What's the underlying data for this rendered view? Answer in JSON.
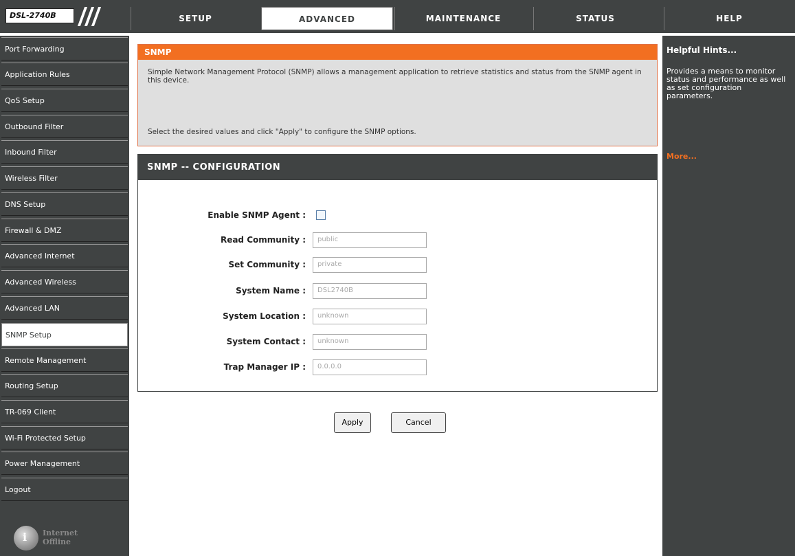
{
  "header": {
    "logo_text": "DSL-2740B",
    "tabs": [
      {
        "label": "SETUP"
      },
      {
        "label": "ADVANCED"
      },
      {
        "label": "MAINTENANCE"
      },
      {
        "label": "STATUS"
      },
      {
        "label": "HELP"
      }
    ],
    "active_tab": "ADVANCED"
  },
  "sidebar": {
    "items": [
      {
        "label": "Port Forwarding"
      },
      {
        "label": "Application Rules"
      },
      {
        "label": "QoS Setup"
      },
      {
        "label": "Outbound Filter"
      },
      {
        "label": "Inbound Filter"
      },
      {
        "label": "Wireless Filter"
      },
      {
        "label": "DNS Setup"
      },
      {
        "label": "Firewall & DMZ"
      },
      {
        "label": "Advanced Internet"
      },
      {
        "label": "Advanced Wireless"
      },
      {
        "label": "Advanced LAN"
      },
      {
        "label": "SNMP Setup"
      },
      {
        "label": "Remote Management"
      },
      {
        "label": "Routing Setup"
      },
      {
        "label": "TR-069 Client"
      },
      {
        "label": "Wi-Fi Protected Setup"
      },
      {
        "label": "Power Management"
      },
      {
        "label": "Logout"
      }
    ],
    "active_item": "SNMP Setup",
    "internet_status": {
      "line1": "Internet",
      "line2": "Offline"
    }
  },
  "main": {
    "snmp": {
      "title": "SNMP",
      "description": "Simple Network Management Protocol (SNMP) allows a management application to retrieve statistics and status from the SNMP agent in this device.",
      "instruction": "Select the desired values and click \"Apply\" to configure the SNMP options."
    },
    "config": {
      "title": "SNMP -- CONFIGURATION",
      "enable_label": "Enable SNMP Agent :",
      "enable_checked": false,
      "fields": [
        {
          "label": "Read Community :",
          "value": "public"
        },
        {
          "label": "Set Community :",
          "value": "private"
        },
        {
          "label": "System Name :",
          "value": "DSL2740B"
        },
        {
          "label": "System Location :",
          "value": "unknown"
        },
        {
          "label": "System Contact :",
          "value": "unknown"
        },
        {
          "label": "Trap Manager IP :",
          "value": "0.0.0.0"
        }
      ]
    },
    "buttons": {
      "apply": "Apply",
      "cancel": "Cancel"
    }
  },
  "hints": {
    "title": "Helpful Hints...",
    "text": "Provides a means to monitor status and performance as well as set configuration parameters.",
    "more": "More..."
  },
  "colors": {
    "dark": "#404343",
    "accent": "#f26f21",
    "panel": "#dfdfdf"
  }
}
